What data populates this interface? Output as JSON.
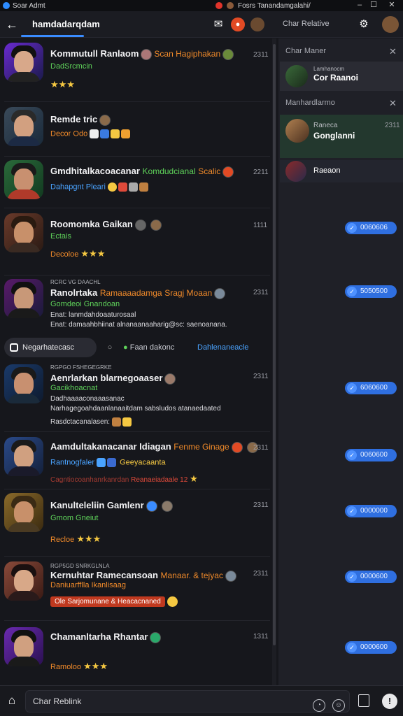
{
  "window": {
    "app_name": "Soar Admt",
    "tab_title": "Fosrs Tanandamgalahi/"
  },
  "toolbar": {
    "title": "hamdadarqdam",
    "chat_relative_label": "Char Relative"
  },
  "chats": [
    {
      "name": "Kommutull Ranlaom",
      "mention": "Scan Hagiphakan",
      "time": "2311",
      "sub_label": "DadSrcmcin",
      "stars": "★★★"
    },
    {
      "name": "Remde tric",
      "time": "",
      "sub_label": "Decor Odo"
    },
    {
      "name": "Gmdhitalkacoacanar",
      "tag1": "Komdudcianal",
      "tag2": "Scalic",
      "time": "2211",
      "sub_label": "Dahapgnt Pleari"
    },
    {
      "name": "Roomomka Gaikan",
      "time": "1111",
      "sub_label": "Ectais",
      "sub2": "Decoloe",
      "stars": "★★★"
    },
    {
      "name": "Ranolrtaka",
      "preheader": "RCRC VG DAACHL",
      "tag1": "Ramaaaadamga",
      "tag2": "Sragj Moaan",
      "time": "2311",
      "sub_label": "Gomdeoi Gnandoan",
      "line1": "Enat: lanmdahdoaaturosaal",
      "line2": "Enat: damaahbhiinat alnanaanaaharig@sc: saenoanana."
    },
    {
      "name": "Aenrlarkan blarnegoaaser",
      "preheader": "RGPGO FSHEGEGRKE",
      "time": "2311",
      "sub_label": "Gacikhoacnat",
      "line1": "Dadhaaaaconaaasanac",
      "line2": "Narhagegoahdaanlanaaitdam sabsludos atanaedaated",
      "line3": "Rasdctacanalasen:"
    },
    {
      "name": "Aamdultakanacanar Idiagan",
      "tag1": "Fenme Ginage",
      "time": "2311",
      "sub_label": "Rantnogfaler",
      "sub_label2": "Geeyacaanta",
      "line1": "Cagntiocoanhanrkanrdan",
      "line2": "Reanaeiadaale 12"
    },
    {
      "name": "Kanulteleliin Gamlenr",
      "time": "2311",
      "sub_label": "Gmom Gneiut",
      "sub2": "Recloe",
      "stars": "★★★"
    },
    {
      "name": "Kernuhtar Ramecansoan",
      "preheader": "RGP5GD SNRKGLNLA",
      "tag1": "Manaar. & tejyac",
      "time": "2311",
      "sub_label": "Daniuarfflla Ikanlisaag",
      "badge": "Ole Sarjomunane & Heacacnaned"
    },
    {
      "name": "Chamanltarha Rhantar",
      "time": "1311",
      "sub_label": "Ramoloo",
      "stars": "★★★"
    }
  ],
  "filter_chips": {
    "chip1": "Negarhatecasc",
    "chip3": "Faan dakonc",
    "chip4": "Dahlenaneacle"
  },
  "panel": {
    "header1": "Char Maner",
    "header2": "Manhardlarmo",
    "item1": {
      "top": "Lamhanocm",
      "name": "Cor Raanoi"
    },
    "item2": {
      "top": "Raneca",
      "name": "Gonglanni",
      "time": "2311"
    },
    "item3": {
      "name": "Raeaon"
    }
  },
  "pills": [
    "0060606",
    "5050500",
    "6060600",
    "0060600",
    "0000000",
    "0000600",
    "0000600"
  ],
  "bottom": {
    "input_value": "Char Reblink"
  },
  "colors": {
    "accent": "#3a8cff",
    "orange": "#f08a2a",
    "green": "#5fd35a",
    "pill": "#2f6fe0",
    "background": "#16171c"
  }
}
